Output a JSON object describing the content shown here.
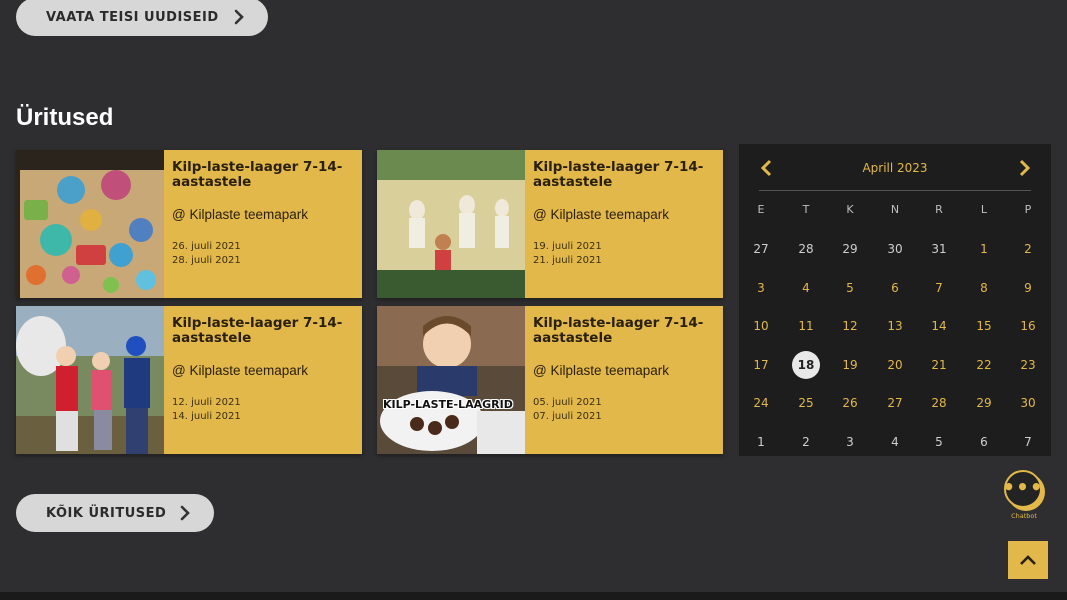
{
  "news": {
    "more_label": "VAATA TEISI UUDISEID"
  },
  "events": {
    "section_title": "Üritused",
    "all_label": "KÕIK ÜRITUSED",
    "cards": [
      {
        "title": "Kilp-laste-laager 7-14-aastastele",
        "location": "@ Kilplaste teemapark",
        "date_start": "26. juuli 2021",
        "date_end": "28. juuli 2021"
      },
      {
        "title": "Kilp-laste-laager 7-14-aastastele",
        "location": "@ Kilplaste teemapark",
        "date_start": "19. juuli 2021",
        "date_end": "21. juuli 2021"
      },
      {
        "title": "Kilp-laste-laager 7-14-aastastele",
        "location": "@ Kilplaste teemapark",
        "date_start": "12. juuli 2021",
        "date_end": "14. juuli 2021"
      },
      {
        "title": "Kilp-laste-laager 7-14-aastastele",
        "location": "@ Kilplaste teemapark",
        "date_start": "05. juuli 2021",
        "date_end": "07. juuli 2021"
      }
    ],
    "card4_photo_caption": "KILP-LASTE-LAAGRID"
  },
  "calendar": {
    "month_label": "Aprill 2023",
    "weekdays": [
      "E",
      "T",
      "K",
      "N",
      "R",
      "L",
      "P"
    ],
    "weeks": [
      [
        "27",
        "28",
        "29",
        "30",
        "31",
        "1",
        "2"
      ],
      [
        "3",
        "4",
        "5",
        "6",
        "7",
        "8",
        "9"
      ],
      [
        "10",
        "11",
        "12",
        "13",
        "14",
        "15",
        "16"
      ],
      [
        "17",
        "18",
        "19",
        "20",
        "21",
        "22",
        "23"
      ],
      [
        "24",
        "25",
        "26",
        "27",
        "28",
        "29",
        "30"
      ],
      [
        "1",
        "2",
        "3",
        "4",
        "5",
        "6",
        "7"
      ]
    ],
    "today": "18"
  },
  "chatbot": {
    "label": "Chatbot"
  },
  "colors": {
    "accent": "#e3b84a",
    "background": "#2e2e30",
    "calendar_bg": "#1d1d1d"
  }
}
